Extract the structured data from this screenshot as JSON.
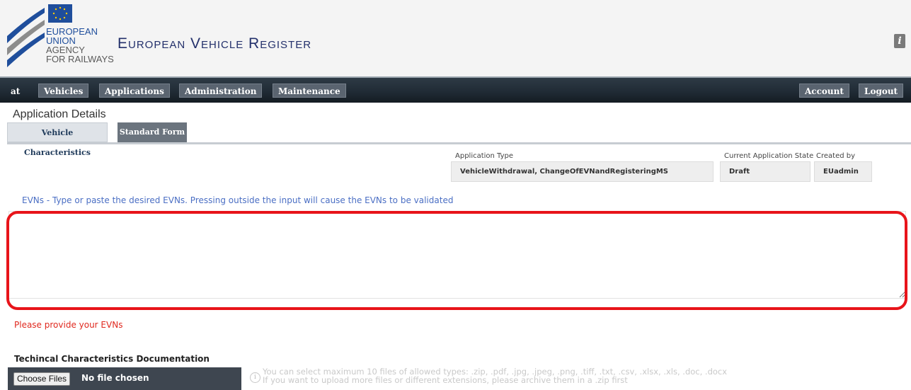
{
  "header": {
    "logo_lines": [
      "EUROPEAN",
      "UNION",
      "AGENCY",
      "FOR RAILWAYS"
    ],
    "site_title": "European Vehicle Register",
    "info_icon": "info-icon"
  },
  "navbar": {
    "user": "at",
    "items": [
      "Vehicles",
      "Applications",
      "Administration",
      "Maintenance"
    ],
    "right_items": [
      "Account",
      "Logout"
    ]
  },
  "page": {
    "title": "Application Details",
    "tabs": [
      "Vehicle Characteristics",
      "Standard Form"
    ]
  },
  "application": {
    "type_label": "Application Type",
    "type_value": "VehicleWithdrawal, ChangeOfEVNandRegisteringMS",
    "state_label": "Current Application State",
    "state_value": "Draft",
    "created_label": "Created by",
    "created_value": "EUadmin"
  },
  "evns": {
    "help": "EVNs - Type or paste the desired EVNs. Pressing outside the input will cause the EVNs to be validated",
    "value": "",
    "error": "Please provide your EVNs"
  },
  "documents": {
    "title": "Techincal Characteristics Documentation",
    "choose_label": "Choose Files",
    "status": "No file chosen",
    "hint_line1": "You can select maximum 10 files of allowed types: .zip, .pdf, .jpg, .jpeg, .png, .tiff, .txt, .csv, .xlsx, .xls, .doc, .docx",
    "hint_line2": "If you want to upload more files or different extensions, please archive them in a .zip first"
  },
  "colors": {
    "accent_blue": "#1f4e9c",
    "navbar": "#1f2a34",
    "error": "#e0281e",
    "highlight": "#e8141a"
  }
}
